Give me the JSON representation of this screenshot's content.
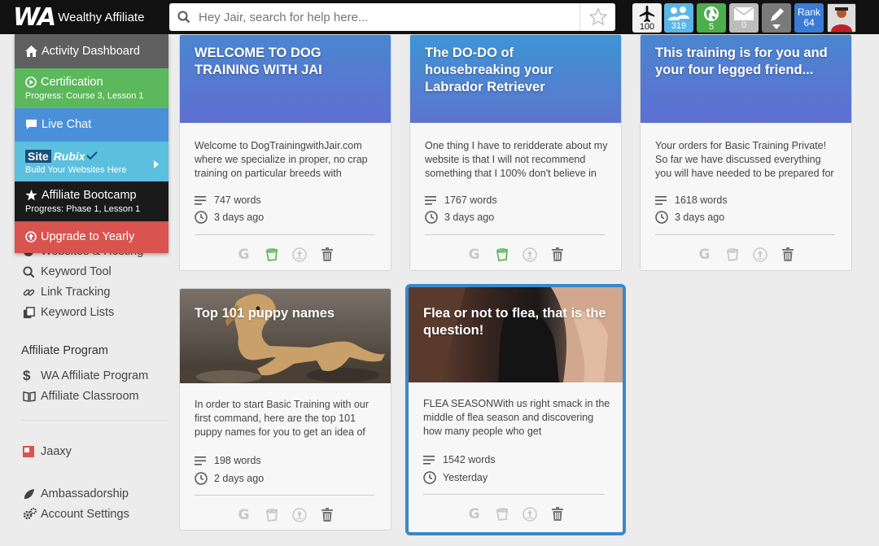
{
  "brand": {
    "name": "Wealthy Affiliate",
    "mark": "WA"
  },
  "search": {
    "placeholder": "Hey Jair, search for help here..."
  },
  "toolbar": {
    "flight_count": "100",
    "users_count": "319",
    "globe_count": "5",
    "mail_count": "0",
    "rank_label": "Rank",
    "rank_value": "64"
  },
  "colors": {
    "green": "#5cb85c",
    "blue": "#4a90d9",
    "teal": "#5bc0de",
    "red": "#d9534f",
    "rank": "#3a7bd5",
    "selected_border": "#3b87c8"
  },
  "dropdown": {
    "activity": "Activity Dashboard",
    "certification": "Certification",
    "certification_progress": "Progress: Course 3, Lesson 1",
    "live_chat": "Live Chat",
    "siterubix_site": "Site",
    "siterubix_rubix": "Rubix",
    "siterubix_sub": "Build Your Websites Here",
    "bootcamp": "Affiliate Bootcamp",
    "bootcamp_progress": "Progress: Phase 1, Lesson 1",
    "upgrade": "Upgrade to Yearly"
  },
  "sidebar": {
    "hidden_item": "Websites & Hosting",
    "keyword_tool": "Keyword Tool",
    "link_tracking": "Link Tracking",
    "keyword_lists": "Keyword Lists",
    "affiliate_section": "Affiliate Program",
    "wa_affiliate": "WA Affiliate Program",
    "affiliate_classroom": "Affiliate Classroom",
    "jaaxy": "Jaaxy",
    "ambassadorship": "Ambassadorship",
    "account_settings": "Account Settings"
  },
  "cards": [
    {
      "title": "WELCOME TO DOG TRAINING WITH JAI",
      "excerpt": "Welcome to DogTrainingwithJair.com where we specialize in proper, no crap training on particular breeds with",
      "words": "747 words",
      "time": "3 days ago"
    },
    {
      "title": "The DO-DO of housebreaking your Labrador Retriever",
      "excerpt": "One thing I have to reridderate about my website is that I will not recommend something that I 100% don't believe in",
      "words": "1767 words",
      "time": "3 days ago"
    },
    {
      "title": "This training is for you and your four legged friend...",
      "excerpt": "Your orders for Basic Training Private! So far we have discussed everything you will have needed to be prepared for",
      "words": "1618 words",
      "time": "3 days ago"
    },
    {
      "title": "Top 101 puppy names",
      "excerpt": "In order to start Basic Training with our first command, here are the top 101 puppy names for you to get an idea of",
      "words": "198 words",
      "time": "2 days ago"
    },
    {
      "title": "Flea or not to flea, that is the question!",
      "excerpt": "FLEA SEASONWith us right smack in the middle of flea season and discovering how many people who get",
      "words": "1542 words",
      "time": "Yesterday"
    }
  ]
}
